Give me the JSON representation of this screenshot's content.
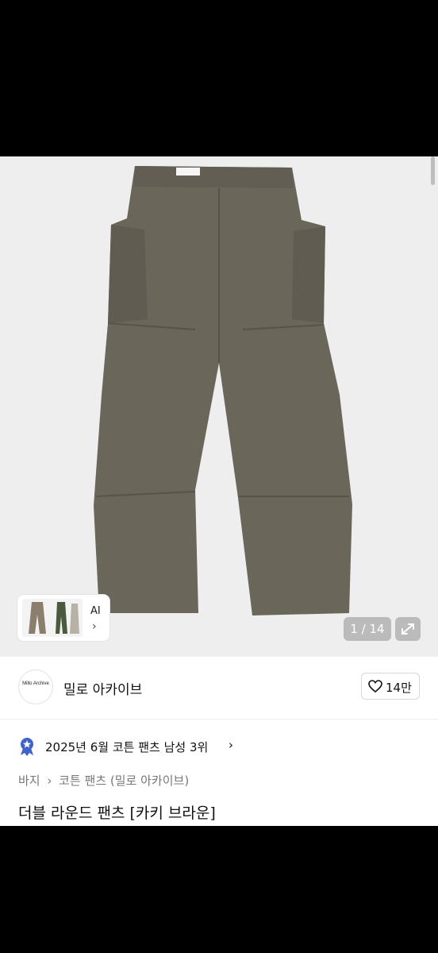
{
  "product_image": {
    "counter": "1 / 14",
    "ai_button": {
      "label": "AI",
      "arrow": "›"
    },
    "expand_icon": "expand-icon"
  },
  "seller": {
    "avatar_text": "Millo Archive",
    "name": "밀로 아카이브",
    "likes": "14만"
  },
  "ranking": {
    "text": "2025년 6월 코튼 팬츠 남성 3위",
    "arrow": "›"
  },
  "breadcrumb": {
    "category": "바지",
    "separator": "›",
    "subcategory": "코튼 팬츠 (밀로 아카이브)"
  },
  "product": {
    "title": "더블 라운드 팬츠 [카키 브라운]"
  },
  "colors": {
    "pants": "#6a665a",
    "background": "#eeeeee",
    "medal": "#3f63c9"
  }
}
